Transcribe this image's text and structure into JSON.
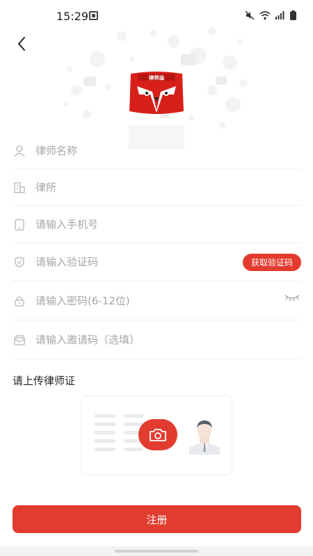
{
  "status_bar": {
    "time": "15:29",
    "icons": [
      "app-notification-icon",
      "mute-icon",
      "wifi-icon",
      "signal-icon",
      "battery-icon"
    ]
  },
  "header": {
    "back_icon": "chevron-left-icon",
    "logo_text": "律师庙"
  },
  "form": {
    "lawyer_name_placeholder": "律师名称",
    "law_firm_placeholder": "律所",
    "phone_placeholder": "请输入手机号",
    "code_placeholder": "请输入验证码",
    "get_code_label": "获取验证码",
    "password_placeholder": "请输入密码(6-12位)",
    "invite_placeholder": "请输入邀请码（选填）"
  },
  "upload": {
    "title": "请上传律师证"
  },
  "register_label": "注册",
  "colors": {
    "accent": "#e13c2f",
    "divider": "#eeeeee",
    "placeholder": "#a6a6a6"
  }
}
